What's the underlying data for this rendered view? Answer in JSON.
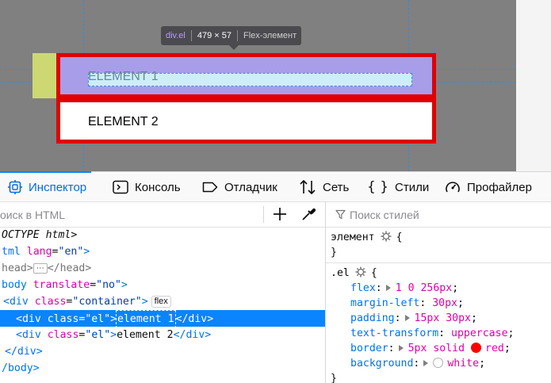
{
  "page": {
    "element1_text": "ELEMENT 1",
    "element2_text": "ELEMENT 2",
    "tooltip": {
      "tag": "div.el",
      "size": "479 × 57",
      "type": "Flex-элемент"
    },
    "colors": {
      "border": "#e00000",
      "content_highlight": "#cbeefa",
      "padding_highlight": "#a89de8",
      "margin_highlight": "#cdd873"
    }
  },
  "toolbar": {
    "tabs": [
      {
        "label": "Инспектор",
        "icon": "inspector-icon"
      },
      {
        "label": "Консоль",
        "icon": "console-icon"
      },
      {
        "label": "Отладчик",
        "icon": "debugger-icon"
      },
      {
        "label": "Сеть",
        "icon": "network-icon"
      },
      {
        "label": "Стили",
        "icon": "style-editor-icon"
      },
      {
        "label": "Профайлер",
        "icon": "profiler-icon"
      }
    ]
  },
  "markup": {
    "search_placeholder": "оиск в HTML",
    "lines": {
      "doctype": "OCTYPE html>",
      "html_open_tag": "tml",
      "html_attr": "lang",
      "html_val": "\"en\"",
      "head_open": "head>",
      "head_close": "</head",
      "body_tag": "body",
      "body_attr": "translate",
      "body_val": "\"no\"",
      "container_tag": "<div",
      "container_attr": "class",
      "container_val": "\"container\"",
      "flex_badge": "flex",
      "ellipsis": "⋯",
      "el1_open": "<div class=\"el\">",
      "el1_text": "element 1",
      "el1_close": "</div>",
      "el2_tag": "<div",
      "el2_attr": "class",
      "el2_val": "\"el\"",
      "el2_text": "element 2",
      "el2_close": "</div>",
      "container_close": "</div>",
      "body_close": "/body>"
    }
  },
  "rules": {
    "filter_placeholder": "Поиск стилей",
    "element_selector": "элемент",
    "el_selector": ".el",
    "declarations": [
      {
        "prop": "flex",
        "value": "1 0 256px",
        "expandable": true
      },
      {
        "prop": "margin-left",
        "value": "30px",
        "expandable": false
      },
      {
        "prop": "padding",
        "value": "15px 30px",
        "expandable": true
      },
      {
        "prop": "text-transform",
        "value": "uppercase",
        "expandable": false
      },
      {
        "prop": "border",
        "value_prefix": "5px solid",
        "color_name": "red",
        "swatch": "#ff0000",
        "expandable": true
      },
      {
        "prop": "background",
        "color_name": "white",
        "swatch": "#ffffff",
        "expandable": true
      }
    ]
  }
}
